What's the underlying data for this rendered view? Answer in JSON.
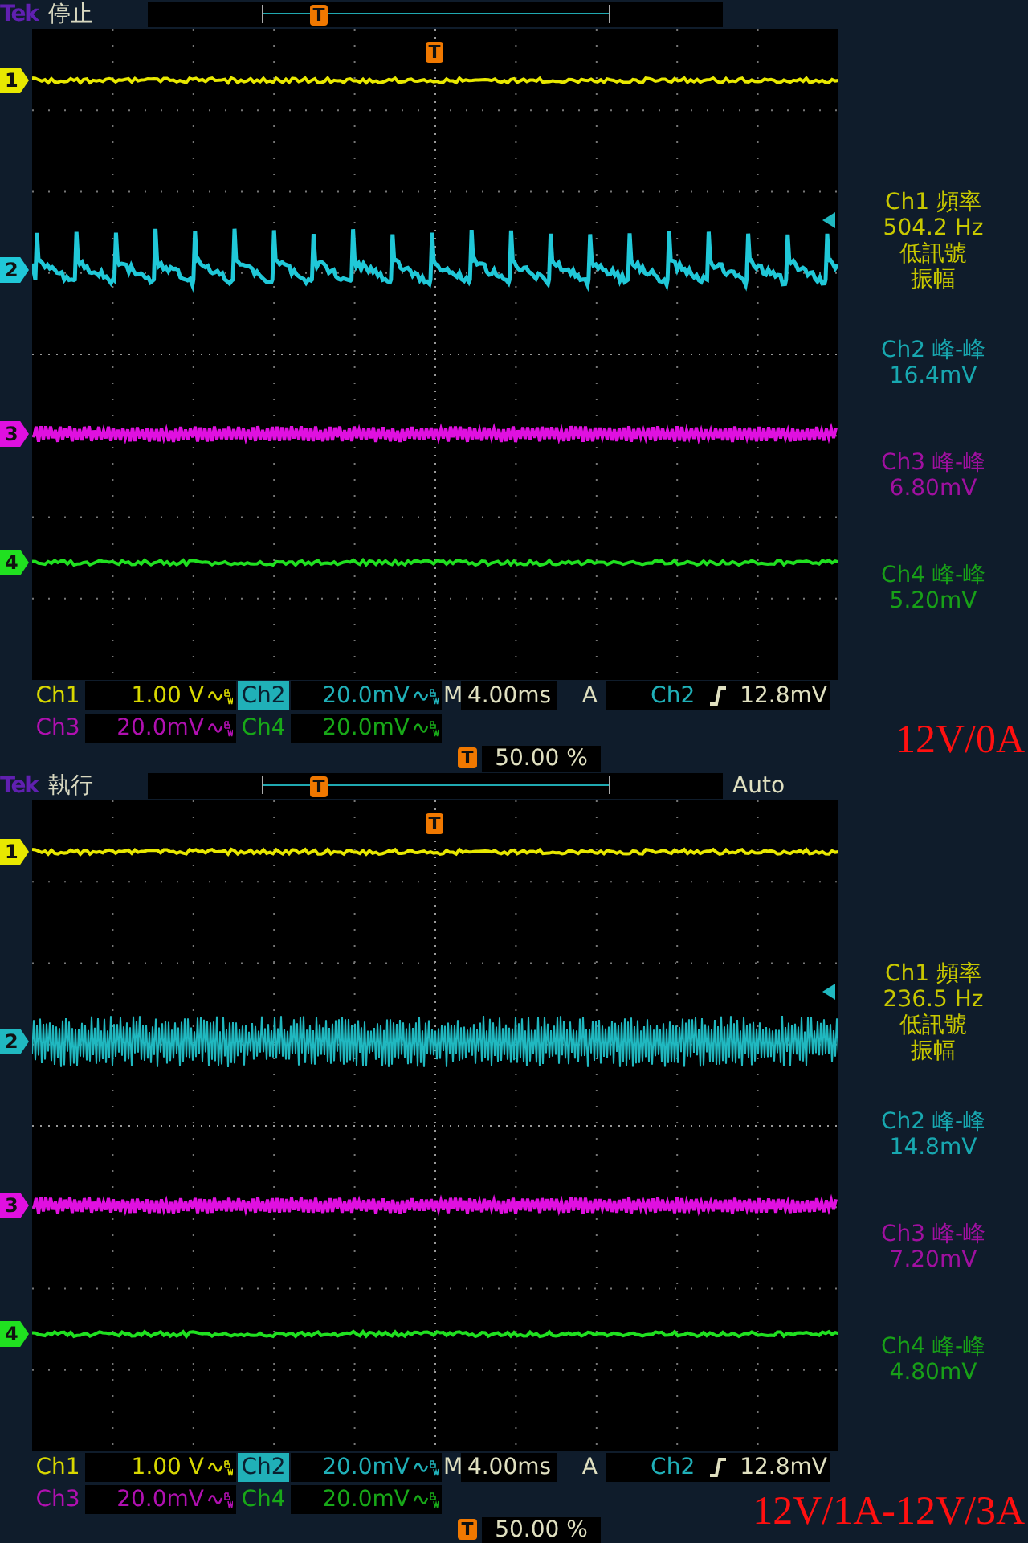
{
  "screens": [
    {
      "brand": "Tek",
      "state": "停止",
      "trigger_marker": "T",
      "overview_marker": "T",
      "channels": [
        {
          "marker": "1",
          "color": "#e8e800",
          "kind": "thin"
        },
        {
          "marker": "2",
          "color": "#20c8d8",
          "kind": "sawtooth"
        },
        {
          "marker": "3",
          "color": "#e010e0",
          "kind": "zigzag"
        },
        {
          "marker": "4",
          "color": "#20e020",
          "kind": "thin"
        }
      ],
      "measurements": [
        {
          "label": "Ch1 頻率",
          "value": "504.2 Hz",
          "notes": [
            "低訊號",
            "振幅"
          ],
          "color": "#c8c800"
        },
        {
          "label": "Ch2 峰-峰",
          "value": "16.4mV",
          "color": "#18a8b0"
        },
        {
          "label": "Ch3 峰-峰",
          "value": "6.80mV",
          "color": "#a010a0"
        },
        {
          "label": "Ch4 峰-峰",
          "value": "5.20mV",
          "color": "#18a018"
        }
      ],
      "readouts": [
        {
          "label": "Ch1",
          "value": "1.00 V",
          "color": "#d8d800",
          "selected": false,
          "bandwidth_limited": true
        },
        {
          "label": "Ch2",
          "value": "20.0mV",
          "color": "#20b0b8",
          "selected": true,
          "bandwidth_limited": true
        },
        {
          "label": "Ch3",
          "value": "20.0mV",
          "color": "#b010b0",
          "selected": false,
          "bandwidth_limited": true
        },
        {
          "label": "Ch4",
          "value": "20.0mV",
          "color": "#18a818",
          "selected": false,
          "bandwidth_limited": true
        }
      ],
      "timebase": {
        "label": "M",
        "value": "4.00ms"
      },
      "trigger": {
        "label": "A",
        "source": "Ch2",
        "threshold": "12.8mV"
      },
      "position": {
        "marker": "T",
        "value": "50.00 %"
      },
      "caption": "12V/0A"
    },
    {
      "brand": "Tek",
      "state": "執行",
      "mode": "Auto",
      "trigger_marker": "T",
      "overview_marker": "T",
      "channels": [
        {
          "marker": "1",
          "color": "#e8e800",
          "kind": "thin"
        },
        {
          "marker": "2",
          "color": "#20b8c0",
          "kind": "band"
        },
        {
          "marker": "3",
          "color": "#e010e0",
          "kind": "zigzag"
        },
        {
          "marker": "4",
          "color": "#20e020",
          "kind": "thin"
        }
      ],
      "measurements": [
        {
          "label": "Ch1 頻率",
          "value": "236.5 Hz",
          "notes": [
            "低訊號",
            "振幅"
          ],
          "color": "#c8c800"
        },
        {
          "label": "Ch2 峰-峰",
          "value": "14.8mV",
          "color": "#18a8b0"
        },
        {
          "label": "Ch3 峰-峰",
          "value": "7.20mV",
          "color": "#a010a0"
        },
        {
          "label": "Ch4 峰-峰",
          "value": "4.80mV",
          "color": "#18a018"
        }
      ],
      "readouts": [
        {
          "label": "Ch1",
          "value": "1.00 V",
          "color": "#d8d800",
          "selected": false,
          "bandwidth_limited": true
        },
        {
          "label": "Ch2",
          "value": "20.0mV",
          "color": "#20b0b8",
          "selected": true,
          "bandwidth_limited": true
        },
        {
          "label": "Ch3",
          "value": "20.0mV",
          "color": "#b010b0",
          "selected": false,
          "bandwidth_limited": true
        },
        {
          "label": "Ch4",
          "value": "20.0mV",
          "color": "#18a818",
          "selected": false,
          "bandwidth_limited": true
        }
      ],
      "timebase": {
        "label": "M",
        "value": "4.00ms"
      },
      "trigger": {
        "label": "A",
        "source": "Ch2",
        "threshold": "12.8mV"
      },
      "position": {
        "marker": "T",
        "value": "50.00 %"
      },
      "caption": "12V/1A-12V/3A"
    }
  ]
}
